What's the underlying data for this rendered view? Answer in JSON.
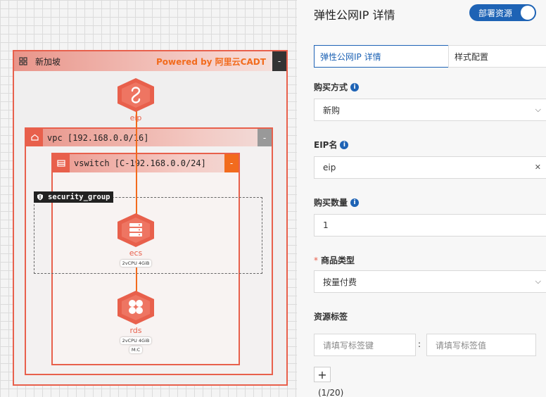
{
  "canvas": {
    "region": {
      "title": "新加坡",
      "powered_by": "Powered by 阿里云CADT",
      "collapse": "-"
    },
    "vpc": {
      "title": "vpc [192.168.0.0/16]",
      "collapse": "-"
    },
    "vswitch": {
      "title": "vswitch [C-192.168.0.0/24]",
      "collapse": "-"
    },
    "security_group": {
      "title": "security_group"
    },
    "nodes": {
      "eip": {
        "label": "eip"
      },
      "ecs": {
        "label": "ecs",
        "spec": "2vCPU  4GiB"
      },
      "rds": {
        "label": "rds",
        "spec": "2vCPU  4GiB",
        "extra": "M:C"
      }
    },
    "colors": {
      "accent": "#e8604c",
      "link": "#f26b1d",
      "brand_blue": "#1e63b5"
    }
  },
  "panel": {
    "title": "弹性公网IP 详情",
    "deploy_label": "部署资源",
    "tabs": [
      {
        "label": "弹性公网IP 详情",
        "active": true
      },
      {
        "label": "样式配置",
        "active": false
      }
    ],
    "fields": {
      "purchase_method": {
        "label": "购买方式",
        "value": "新购",
        "icon": "info-icon"
      },
      "eip_name": {
        "label": "EIP名",
        "value": "eip",
        "icon": "info-icon"
      },
      "quantity": {
        "label": "购买数量",
        "value": "1",
        "icon": "info-icon"
      },
      "product_type": {
        "label": "商品类型",
        "required_mark": "*",
        "value": "按量付费"
      }
    },
    "tags": {
      "label": "资源标签",
      "key_placeholder": "请填写标签键",
      "separator": ":",
      "value_placeholder": "请填写标签值",
      "add": "+",
      "count": "(1/20)"
    }
  }
}
